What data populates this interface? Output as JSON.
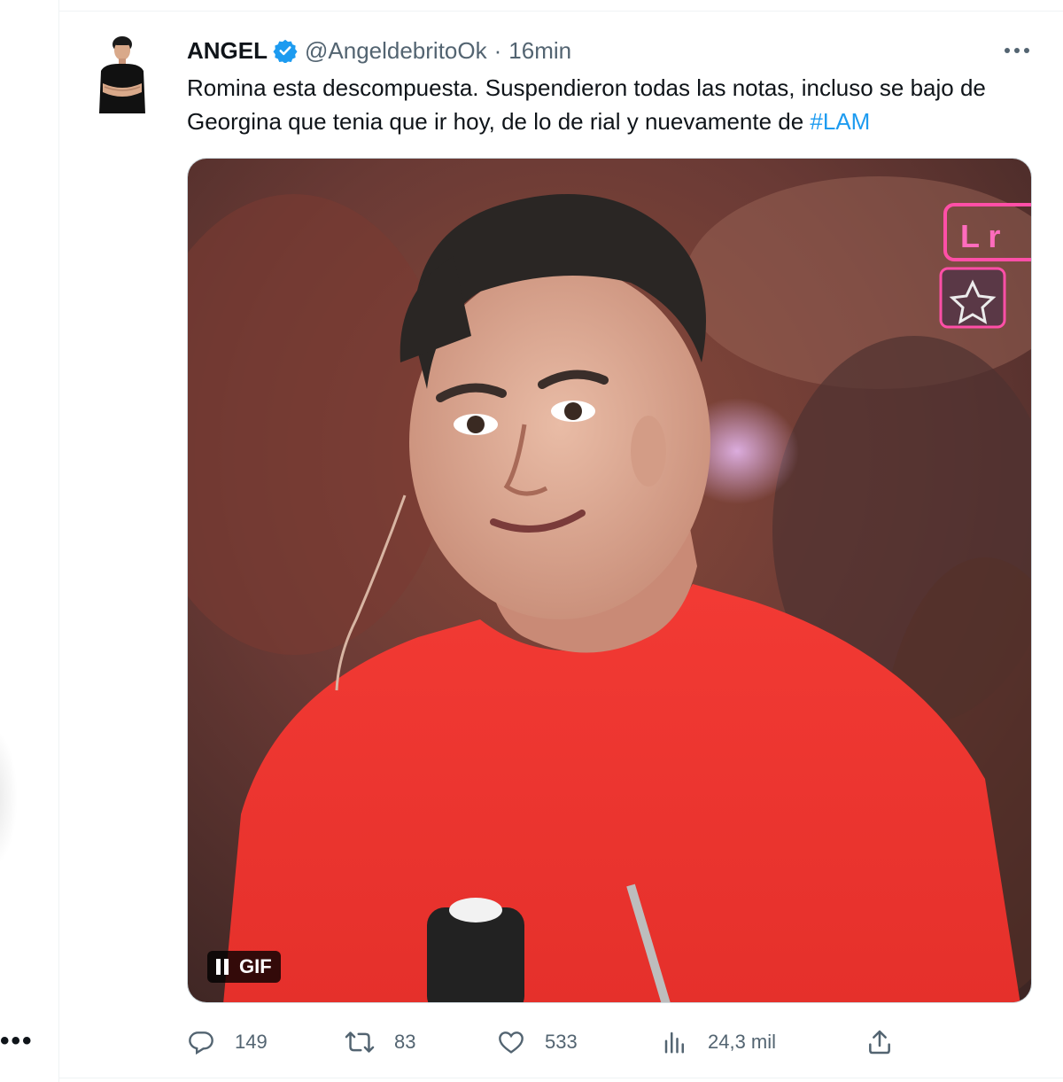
{
  "left_rail": {
    "more_glyph": "•••"
  },
  "tweet": {
    "author": {
      "name": "ANGEL",
      "handle": "@AngeldebritoOk",
      "verified": true,
      "verified_color": "#1d9bf0",
      "avatar_icon": "person-avatar"
    },
    "separator": "·",
    "time": "16min",
    "more_icon": "more-horizontal-icon",
    "text": "Romina esta descompuesta. Suspendieron todas las notas, incluso se bajo de Georgina que tenia que ir hoy, de lo de rial y nuevamente de ",
    "hashtag": "#LAM",
    "media": {
      "type": "gif",
      "badge_label": "GIF",
      "pause_icon": "pause-icon",
      "content": "man in red t-shirt on TV studio set"
    },
    "stats": {
      "replies": "149",
      "retweets": "83",
      "likes": "533",
      "views": "24,3 mil"
    }
  },
  "colors": {
    "text_primary": "#0f1419",
    "text_secondary": "#536471",
    "accent": "#1d9bf0",
    "border": "#eff3f4"
  }
}
